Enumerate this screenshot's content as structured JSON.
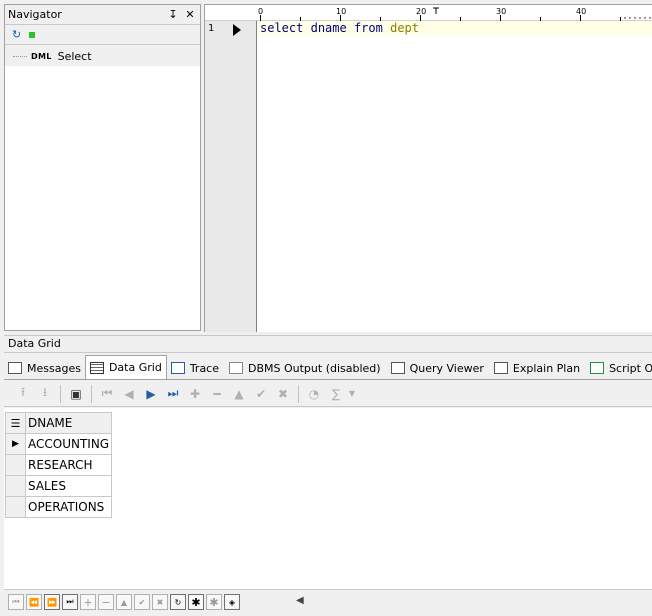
{
  "navigator": {
    "title": "Navigator",
    "pin_icon": "pin-icon",
    "close_icon": "close-icon",
    "tree_item": {
      "tag": "DML",
      "label": "Select"
    }
  },
  "editor": {
    "ruler": {
      "ticks": [
        "0",
        "10",
        "20",
        "30",
        "40"
      ]
    },
    "line_number": "1",
    "code": {
      "kw1": "select",
      "col": "dname",
      "kw2": "from",
      "table": "dept"
    }
  },
  "data_grid_label": "Data Grid",
  "tabs": [
    {
      "label": "Messages",
      "icon": "messages-icon"
    },
    {
      "label": "Data Grid",
      "icon": "grid-icon",
      "active": true
    },
    {
      "label": "Trace",
      "icon": "trace-icon"
    },
    {
      "label": "DBMS Output (disabled)",
      "icon": "dbms-icon"
    },
    {
      "label": "Query Viewer",
      "icon": "document-icon"
    },
    {
      "label": "Explain Plan",
      "icon": "plan-icon"
    },
    {
      "label": "Script Output",
      "icon": "script-icon"
    }
  ],
  "grid": {
    "column": "DNAME",
    "rows": [
      "ACCOUNTING",
      "RESEARCH",
      "SALES",
      "OPERATIONS"
    ]
  },
  "colors": {
    "editor_line": "#ffffe8",
    "keyword": "#000080",
    "table_name": "#8b8000"
  }
}
